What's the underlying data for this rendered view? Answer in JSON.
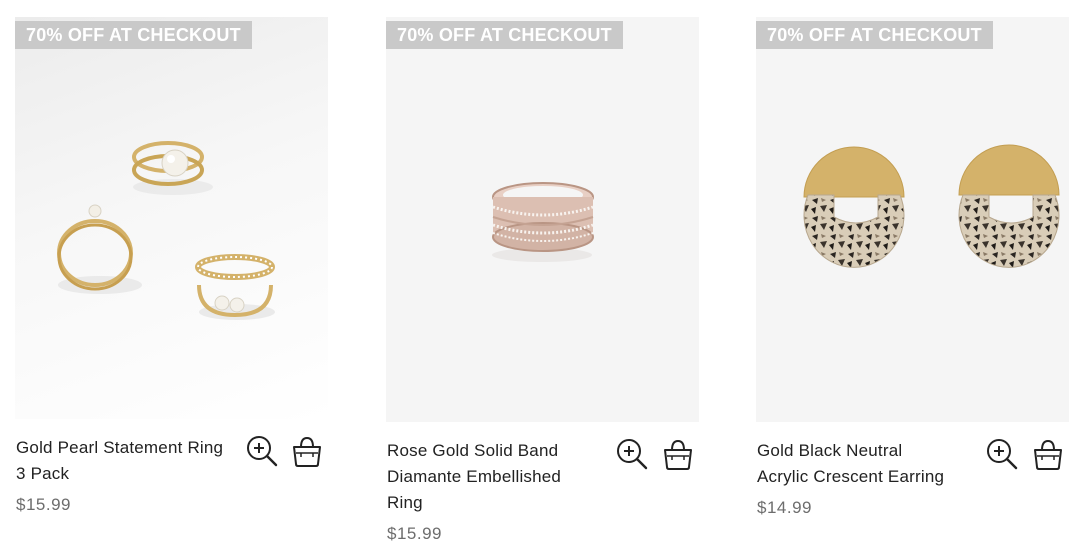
{
  "products": [
    {
      "badge": "70% OFF AT CHECKOUT",
      "title": "Gold Pearl Statement Ring 3 Pack",
      "price": "$15.99",
      "image_icon": "gold-pearl-rings-image"
    },
    {
      "badge": "70% OFF AT CHECKOUT",
      "title": "Rose Gold Solid Band Diamante Embellished Ring",
      "price": "$15.99",
      "image_icon": "rose-gold-ring-image"
    },
    {
      "badge": "70% OFF AT CHECKOUT",
      "title": "Gold Black Neutral Acrylic Crescent Earring",
      "price": "$14.99",
      "image_icon": "crescent-earring-image"
    }
  ],
  "icons": {
    "zoom": "zoom-in-icon",
    "bag": "shopping-bag-icon"
  },
  "colors": {
    "badge_bg": "#c9c9c9",
    "badge_text": "#ffffff",
    "title_text": "#222222",
    "price_text": "#6d6d6d",
    "gold": "#d4b26a"
  }
}
